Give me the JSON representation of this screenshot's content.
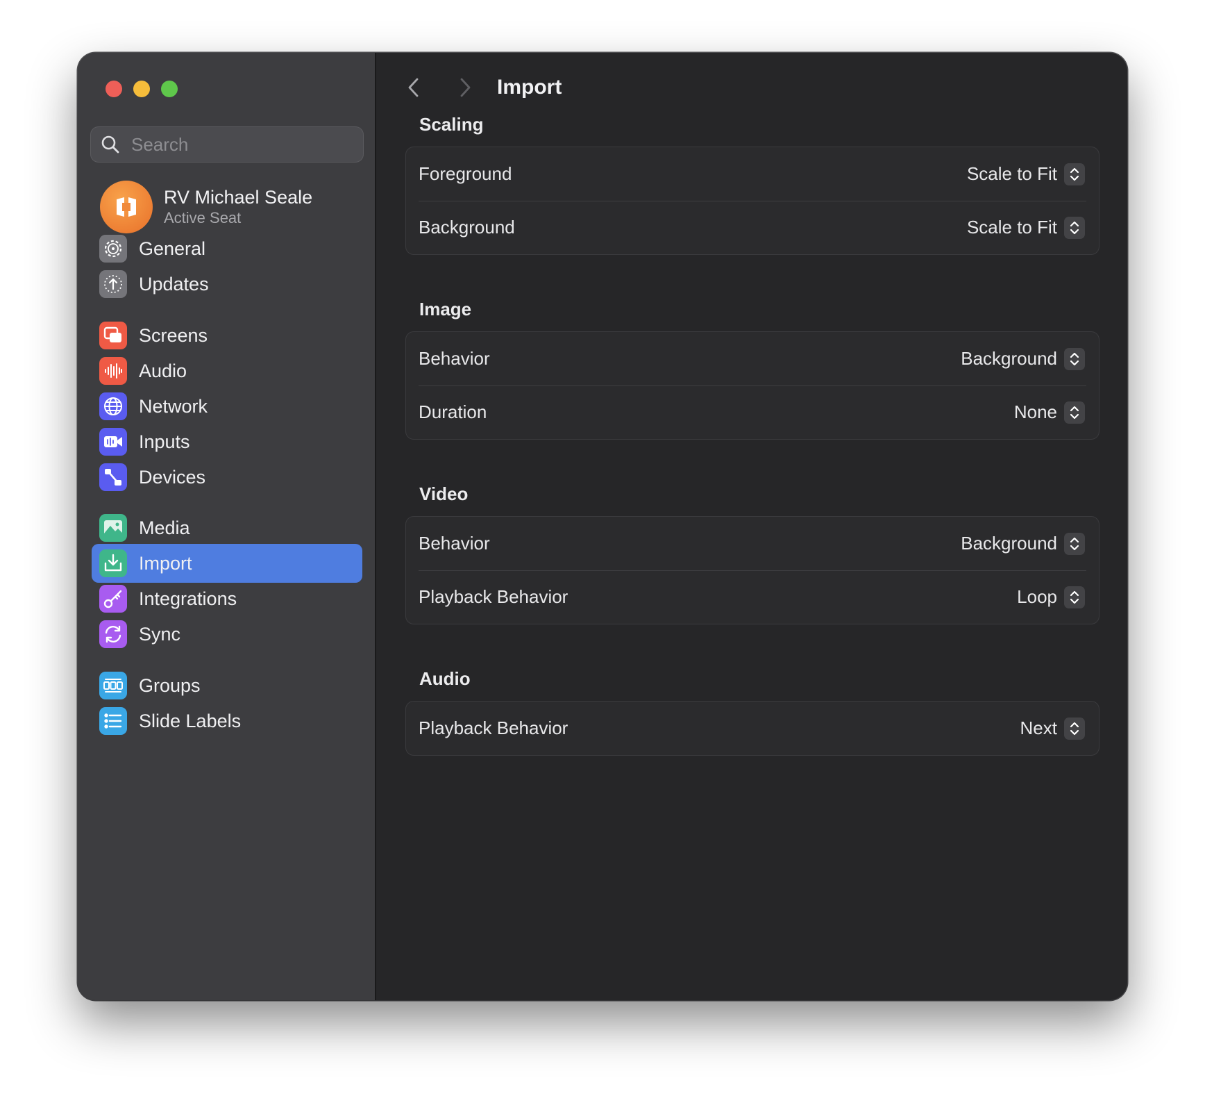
{
  "window": {
    "search": {
      "placeholder": "Search"
    },
    "account": {
      "name": "RV Michael Seale",
      "subtitle": "Active Seat"
    },
    "sidebar": {
      "items": [
        {
          "id": "general",
          "label": "General",
          "icon": "gear-icon",
          "color": "#7b7b7f"
        },
        {
          "id": "updates",
          "label": "Updates",
          "icon": "update-arrow-icon",
          "color": "#7b7b7f"
        },
        {
          "id": "screens",
          "label": "Screens",
          "icon": "screens-icon",
          "color": "#ef5a45"
        },
        {
          "id": "audio",
          "label": "Audio",
          "icon": "waveform-icon",
          "color": "#ef5a45"
        },
        {
          "id": "network",
          "label": "Network",
          "icon": "globe-icon",
          "color": "#5a5cf0"
        },
        {
          "id": "inputs",
          "label": "Inputs",
          "icon": "video-input-icon",
          "color": "#5a5cf0"
        },
        {
          "id": "devices",
          "label": "Devices",
          "icon": "devices-icon",
          "color": "#5a5cf0"
        },
        {
          "id": "media",
          "label": "Media",
          "icon": "photo-icon",
          "color": "#3fb68a"
        },
        {
          "id": "import",
          "label": "Import",
          "icon": "import-tray-icon",
          "color": "#3fb68a",
          "selected": true
        },
        {
          "id": "integrations",
          "label": "Integrations",
          "icon": "key-icon",
          "color": "#a85cf0"
        },
        {
          "id": "sync",
          "label": "Sync",
          "icon": "sync-icon",
          "color": "#a85cf0"
        },
        {
          "id": "groups",
          "label": "Groups",
          "icon": "groups-icon",
          "color": "#3aa7e6"
        },
        {
          "id": "slide-labels",
          "label": "Slide Labels",
          "icon": "list-icon",
          "color": "#3aa7e6"
        }
      ]
    }
  },
  "main": {
    "title": "Import",
    "sections": [
      {
        "title": "Scaling",
        "rows": [
          {
            "label": "Foreground",
            "value": "Scale to Fit"
          },
          {
            "label": "Background",
            "value": "Scale to Fit"
          }
        ]
      },
      {
        "title": "Image",
        "rows": [
          {
            "label": "Behavior",
            "value": "Background"
          },
          {
            "label": "Duration",
            "value": "None"
          }
        ]
      },
      {
        "title": "Video",
        "rows": [
          {
            "label": "Behavior",
            "value": "Background"
          },
          {
            "label": "Playback Behavior",
            "value": "Loop"
          }
        ]
      },
      {
        "title": "Audio",
        "rows": [
          {
            "label": "Playback Behavior",
            "value": "Next"
          }
        ]
      }
    ]
  }
}
